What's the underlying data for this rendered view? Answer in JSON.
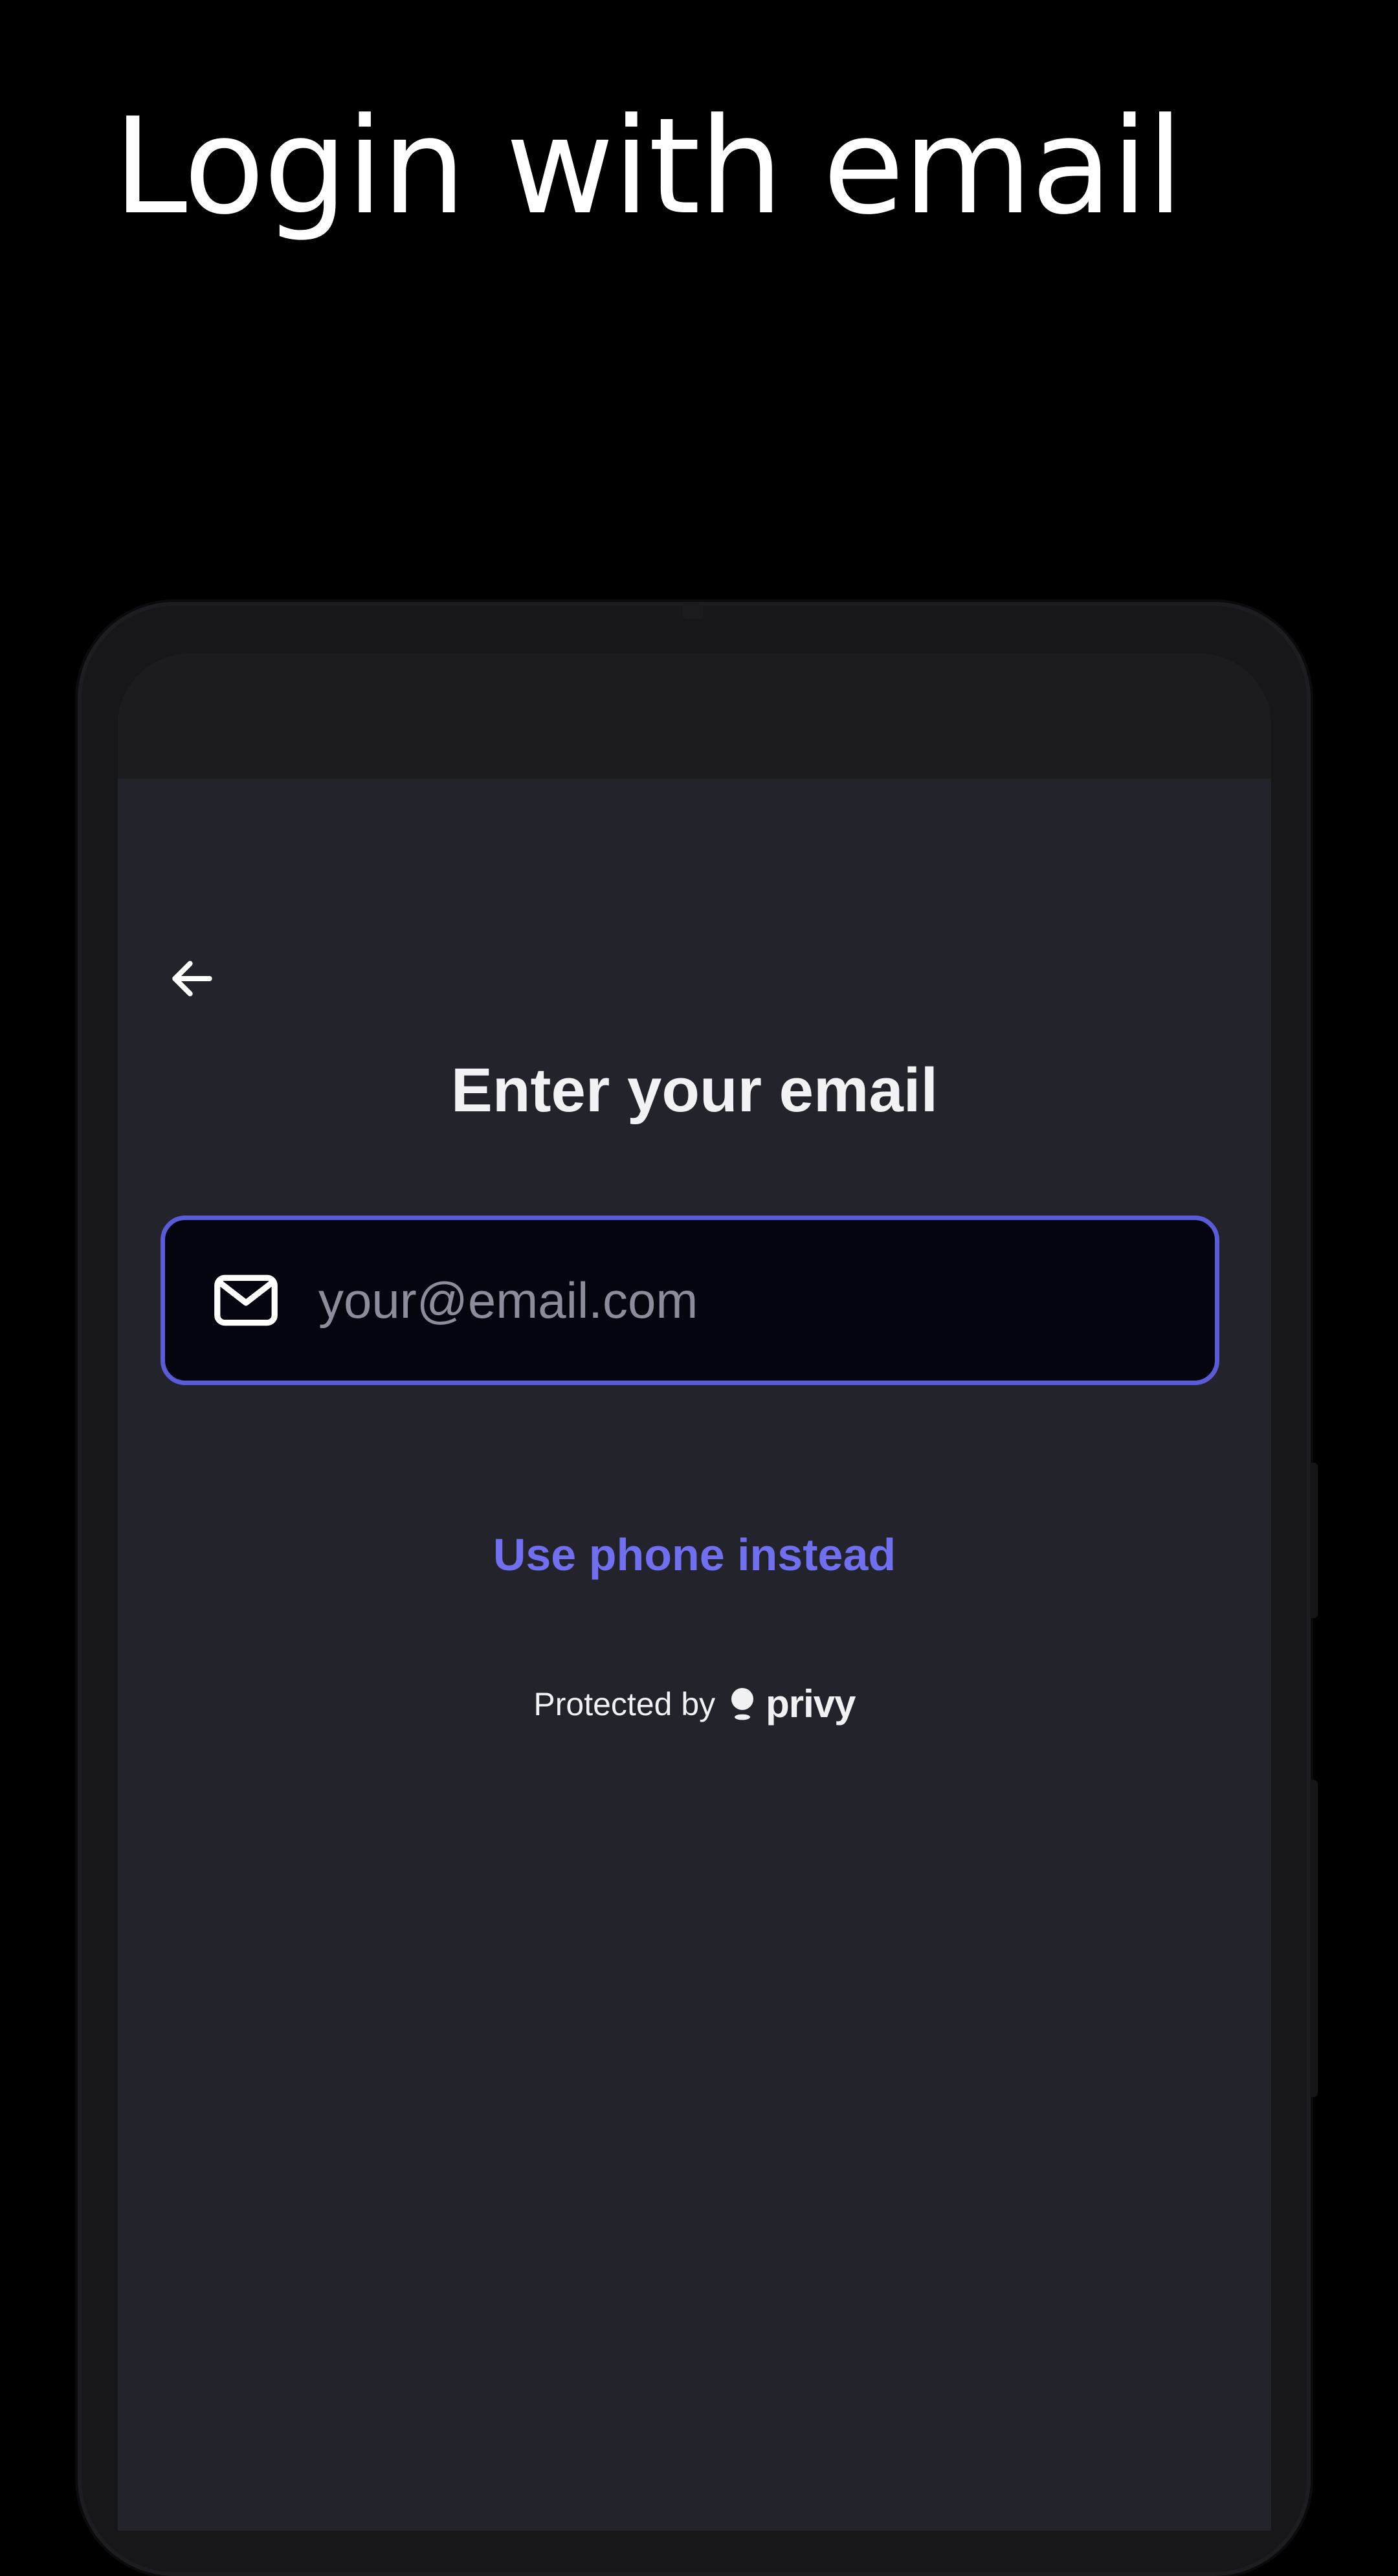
{
  "headline": "Login with email",
  "modal": {
    "title": "Enter your email",
    "back_icon": "arrow-left-icon",
    "email_input": {
      "value": "",
      "placeholder": "your@email.com",
      "icon": "envelope-icon"
    },
    "alt_login_link": "Use phone instead",
    "footer": {
      "protected_by": "Protected by",
      "brand": "privy",
      "brand_icon": "privy-logo-icon"
    }
  },
  "colors": {
    "background": "#000000",
    "screen_bg": "#22232b",
    "status_bar_bg": "#1c1c1e",
    "input_bg": "#05050f",
    "accent": "#5a5bd8",
    "link": "#6f6ff0",
    "text": "#f2f2f4",
    "placeholder": "#8c8d9b"
  }
}
